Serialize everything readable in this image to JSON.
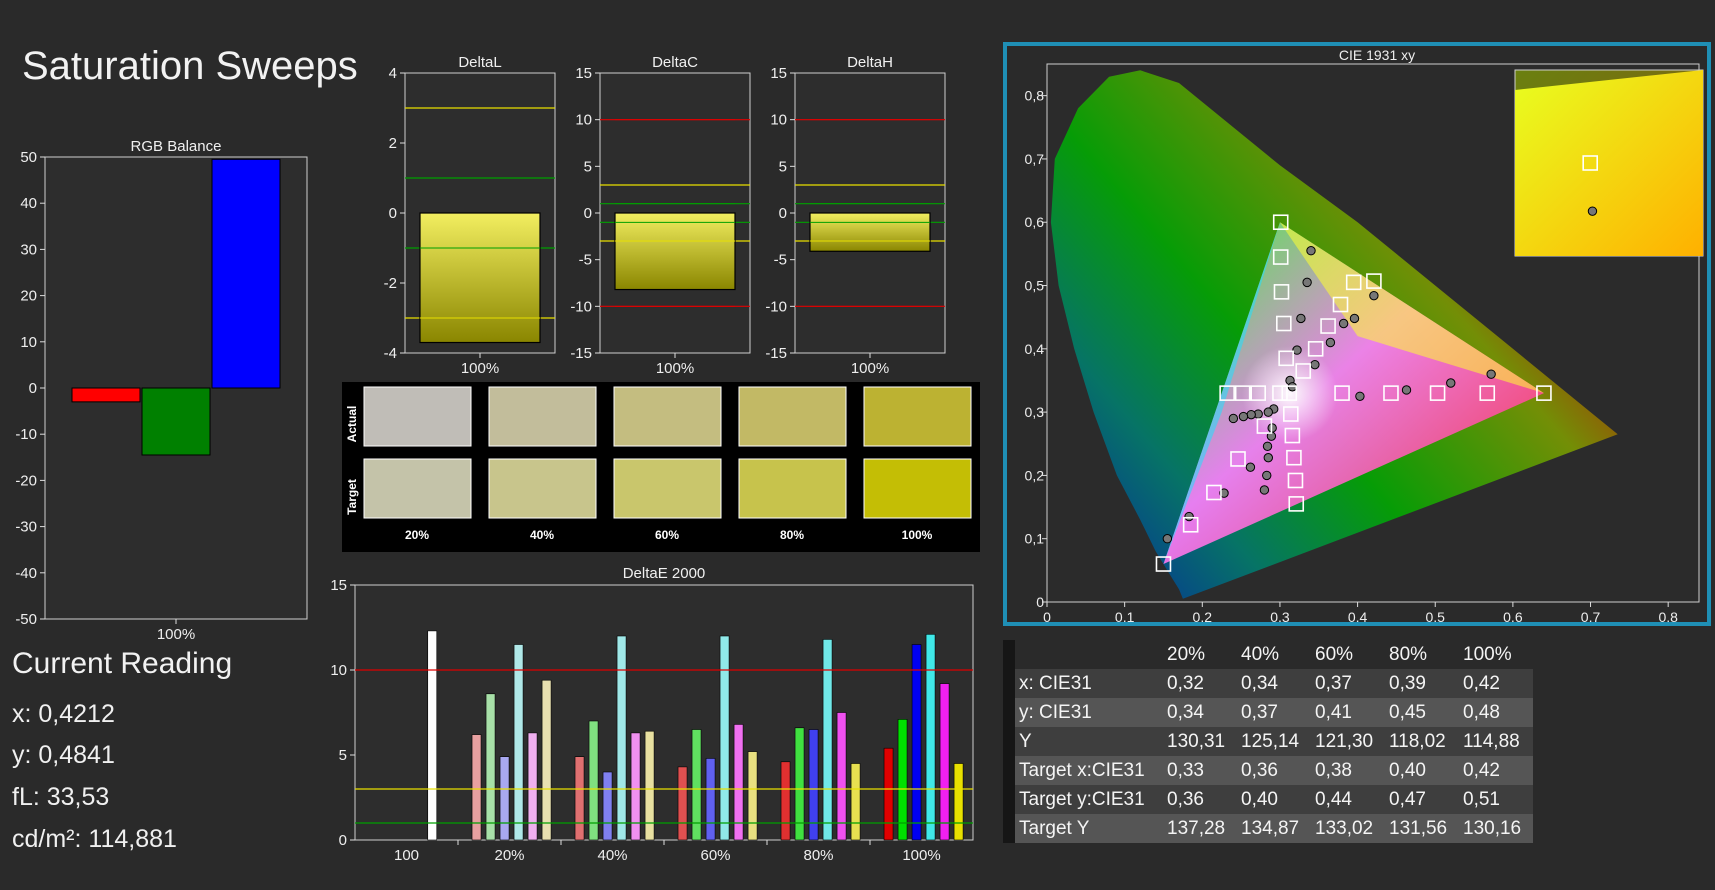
{
  "page": {
    "title": "Saturation Sweeps"
  },
  "reading": {
    "title": "Current Reading",
    "x": "x: 0,4212",
    "y": "y: 0,4841",
    "fl": "fL: 33,53",
    "cd": "cd/m²: 114,881"
  },
  "swatches": {
    "actual_label": "Actual",
    "target_label": "Target",
    "columns": [
      "20%",
      "40%",
      "60%",
      "80%",
      "100%"
    ],
    "actual_colors": [
      "#c0bdb7",
      "#c2bd9b",
      "#c4bd80",
      "#c2b965",
      "#bcb232"
    ],
    "target_colors": [
      "#c4c3a9",
      "#c8c58c",
      "#c9c66c",
      "#c7c34c",
      "#c4be05"
    ]
  },
  "table": {
    "headers": [
      "20%",
      "40%",
      "60%",
      "80%",
      "100%"
    ],
    "rows": [
      {
        "label": "x: CIE31",
        "values": [
          "0,32",
          "0,34",
          "0,37",
          "0,39",
          "0,42"
        ]
      },
      {
        "label": "y: CIE31",
        "values": [
          "0,34",
          "0,37",
          "0,41",
          "0,45",
          "0,48"
        ]
      },
      {
        "label": "Y",
        "values": [
          "130,31",
          "125,14",
          "121,30",
          "118,02",
          "114,88"
        ]
      },
      {
        "label": "Target x:CIE31",
        "values": [
          "0,33",
          "0,36",
          "0,38",
          "0,40",
          "0,42"
        ]
      },
      {
        "label": "Target y:CIE31",
        "values": [
          "0,36",
          "0,40",
          "0,44",
          "0,47",
          "0,51"
        ]
      },
      {
        "label": "Target Y",
        "values": [
          "137,28",
          "134,87",
          "133,02",
          "131,56",
          "130,16"
        ]
      }
    ]
  },
  "chart_data": [
    {
      "id": "rgb-balance",
      "type": "bar",
      "title": "RGB Balance",
      "categories": [
        "100%"
      ],
      "series": [
        {
          "values": [
            -3
          ],
          "color": "#ff0000"
        },
        {
          "values": [
            -14.5
          ],
          "color": "#008000"
        },
        {
          "values": [
            49.5
          ],
          "color": "#0000ff"
        }
      ],
      "ylim": [
        -50,
        50
      ],
      "yticks": [
        "50",
        "40",
        "30",
        "20",
        "10",
        "0",
        "-10",
        "-20",
        "-30",
        "-40",
        "-50"
      ],
      "yticks_values": [
        50,
        40,
        30,
        20,
        10,
        0,
        -10,
        -20,
        -30,
        -40,
        -50
      ],
      "xlabel": "100%"
    },
    {
      "id": "delta-l",
      "type": "bar",
      "title": "DeltaL",
      "categories": [
        "100%"
      ],
      "values": [
        -3.7
      ],
      "ylim": [
        -4,
        4
      ],
      "yticks": [
        "4",
        "2",
        "0",
        "-2",
        "-4"
      ],
      "yticks_values": [
        4,
        2,
        0,
        -2,
        -4
      ],
      "ref_lines": [
        {
          "y": 3,
          "color": "#e8e000"
        },
        {
          "y": 1,
          "color": "#00a000"
        },
        {
          "y": -1,
          "color": "#00a000"
        },
        {
          "y": -3,
          "color": "#e8e000"
        }
      ],
      "xlabel": "100%"
    },
    {
      "id": "delta-c",
      "type": "bar",
      "title": "DeltaC",
      "categories": [
        "100%"
      ],
      "values": [
        -8.2
      ],
      "ylim": [
        -15,
        15
      ],
      "yticks": [
        "15",
        "10",
        "5",
        "0",
        "-5",
        "-10",
        "-15"
      ],
      "yticks_values": [
        15,
        10,
        5,
        0,
        -5,
        -10,
        -15
      ],
      "ref_lines": [
        {
          "y": 10,
          "color": "#e00000"
        },
        {
          "y": 3,
          "color": "#e8e000"
        },
        {
          "y": 1,
          "color": "#00a000"
        },
        {
          "y": -1,
          "color": "#00a000"
        },
        {
          "y": -3,
          "color": "#e8e000"
        },
        {
          "y": -10,
          "color": "#e00000"
        }
      ],
      "xlabel": "100%"
    },
    {
      "id": "delta-h",
      "type": "bar",
      "title": "DeltaH",
      "categories": [
        "100%"
      ],
      "values": [
        -4.1
      ],
      "ylim": [
        -15,
        15
      ],
      "yticks": [
        "15",
        "10",
        "5",
        "0",
        "-5",
        "-10",
        "-15"
      ],
      "yticks_values": [
        15,
        10,
        5,
        0,
        -5,
        -10,
        -15
      ],
      "ref_lines": [
        {
          "y": 10,
          "color": "#e00000"
        },
        {
          "y": 3,
          "color": "#e8e000"
        },
        {
          "y": 1,
          "color": "#00a000"
        },
        {
          "y": -1,
          "color": "#00a000"
        },
        {
          "y": -3,
          "color": "#e8e000"
        },
        {
          "y": -10,
          "color": "#e00000"
        }
      ],
      "xlabel": "100%"
    },
    {
      "id": "delta-e",
      "type": "bar",
      "title": "DeltaE 2000",
      "categories": [
        "100",
        "20%",
        "40%",
        "60%",
        "80%",
        "100%"
      ],
      "groups": [
        {
          "label": "100",
          "bars": [
            {
              "v": 12.3,
              "c": "#ffffff"
            }
          ]
        },
        {
          "label": "20%",
          "bars": [
            {
              "v": 6.2,
              "c": "#e8a0a0"
            },
            {
              "v": 8.6,
              "c": "#a8e0a8"
            },
            {
              "v": 4.9,
              "c": "#a8a8f0"
            },
            {
              "v": 11.5,
              "c": "#b0e8e8"
            },
            {
              "v": 6.3,
              "c": "#f0b0f0"
            },
            {
              "v": 9.4,
              "c": "#e8e0b0"
            }
          ]
        },
        {
          "label": "40%",
          "bars": [
            {
              "v": 4.9,
              "c": "#e07070"
            },
            {
              "v": 7.0,
              "c": "#80e080"
            },
            {
              "v": 4.0,
              "c": "#8080f0"
            },
            {
              "v": 12.0,
              "c": "#a0e8e8"
            },
            {
              "v": 6.3,
              "c": "#f090f0"
            },
            {
              "v": 6.4,
              "c": "#e8e0a0"
            }
          ]
        },
        {
          "label": "60%",
          "bars": [
            {
              "v": 4.3,
              "c": "#e05050"
            },
            {
              "v": 6.5,
              "c": "#60e060"
            },
            {
              "v": 4.8,
              "c": "#6060f0"
            },
            {
              "v": 12.0,
              "c": "#90e8e8"
            },
            {
              "v": 6.8,
              "c": "#f070f0"
            },
            {
              "v": 5.2,
              "c": "#e8e080"
            }
          ]
        },
        {
          "label": "80%",
          "bars": [
            {
              "v": 4.6,
              "c": "#e03030"
            },
            {
              "v": 6.6,
              "c": "#40e040"
            },
            {
              "v": 6.5,
              "c": "#4040f0"
            },
            {
              "v": 11.8,
              "c": "#70e8e8"
            },
            {
              "v": 7.5,
              "c": "#f050f0"
            },
            {
              "v": 4.5,
              "c": "#e8e050"
            }
          ]
        },
        {
          "label": "100%",
          "bars": [
            {
              "v": 5.4,
              "c": "#e00000"
            },
            {
              "v": 7.1,
              "c": "#00e000"
            },
            {
              "v": 11.5,
              "c": "#0000f0"
            },
            {
              "v": 12.1,
              "c": "#40e8e8"
            },
            {
              "v": 9.2,
              "c": "#f020f0"
            },
            {
              "v": 4.5,
              "c": "#e8e000"
            }
          ]
        }
      ],
      "ylim": [
        0,
        15
      ],
      "yticks": [
        "15",
        "10",
        "5",
        "0"
      ],
      "yticks_values": [
        15,
        10,
        5,
        0
      ],
      "ref_lines": [
        {
          "y": 10,
          "color": "#e00000"
        },
        {
          "y": 3,
          "color": "#e8e000"
        },
        {
          "y": 1,
          "color": "#00a000"
        }
      ]
    },
    {
      "id": "cie-1931",
      "type": "scatter",
      "title": "CIE 1931 xy",
      "xlim": [
        0,
        0.85
      ],
      "ylim": [
        0,
        0.85
      ],
      "xticks": [
        "0",
        "0,1",
        "0,2",
        "0,3",
        "0,4",
        "0,5",
        "0,6",
        "0,7",
        "0,8"
      ],
      "xticks_values": [
        0,
        0.1,
        0.2,
        0.3,
        0.4,
        0.5,
        0.6,
        0.7,
        0.8
      ],
      "yticks": [
        "0,8",
        "0,7",
        "0,6",
        "0,5",
        "0,4",
        "0,3",
        "0,2",
        "0,1",
        "0"
      ],
      "yticks_values": [
        0.8,
        0.7,
        0.6,
        0.5,
        0.4,
        0.3,
        0.2,
        0.1,
        0
      ],
      "gamut": [
        [
          0.64,
          0.33
        ],
        [
          0.3,
          0.6
        ],
        [
          0.15,
          0.06
        ]
      ],
      "white": [
        0.3127,
        0.329
      ],
      "targets": [
        [
          0.301,
          0.6
        ],
        [
          0.301,
          0.545
        ],
        [
          0.302,
          0.49
        ],
        [
          0.305,
          0.44
        ],
        [
          0.308,
          0.385
        ],
        [
          0.3,
          0.33
        ],
        [
          0.312,
          0.33
        ],
        [
          0.272,
          0.33
        ],
        [
          0.252,
          0.33
        ],
        [
          0.232,
          0.33
        ],
        [
          0.38,
          0.33
        ],
        [
          0.443,
          0.33
        ],
        [
          0.503,
          0.33
        ],
        [
          0.567,
          0.33
        ],
        [
          0.64,
          0.33
        ],
        [
          0.28,
          0.278
        ],
        [
          0.246,
          0.226
        ],
        [
          0.215,
          0.173
        ],
        [
          0.185,
          0.122
        ],
        [
          0.15,
          0.06
        ],
        [
          0.314,
          0.297
        ],
        [
          0.316,
          0.263
        ],
        [
          0.318,
          0.228
        ],
        [
          0.32,
          0.192
        ],
        [
          0.321,
          0.155
        ],
        [
          0.33,
          0.365
        ],
        [
          0.346,
          0.4
        ],
        [
          0.362,
          0.436
        ],
        [
          0.378,
          0.47
        ],
        [
          0.395,
          0.505
        ],
        [
          0.421,
          0.507
        ]
      ],
      "measured": [
        [
          0.34,
          0.555
        ],
        [
          0.335,
          0.505
        ],
        [
          0.327,
          0.448
        ],
        [
          0.322,
          0.398
        ],
        [
          0.313,
          0.35
        ],
        [
          0.316,
          0.34
        ],
        [
          0.292,
          0.305
        ],
        [
          0.285,
          0.3
        ],
        [
          0.272,
          0.297
        ],
        [
          0.263,
          0.296
        ],
        [
          0.253,
          0.293
        ],
        [
          0.24,
          0.29
        ],
        [
          0.403,
          0.325
        ],
        [
          0.463,
          0.335
        ],
        [
          0.52,
          0.346
        ],
        [
          0.572,
          0.36
        ],
        [
          0.29,
          0.275
        ],
        [
          0.284,
          0.246
        ],
        [
          0.262,
          0.213
        ],
        [
          0.228,
          0.172
        ],
        [
          0.183,
          0.135
        ],
        [
          0.155,
          0.1
        ],
        [
          0.289,
          0.262
        ],
        [
          0.285,
          0.228
        ],
        [
          0.283,
          0.2
        ],
        [
          0.28,
          0.177
        ],
        [
          0.345,
          0.375
        ],
        [
          0.365,
          0.41
        ],
        [
          0.382,
          0.44
        ],
        [
          0.396,
          0.448
        ],
        [
          0.421,
          0.484
        ]
      ],
      "inset": {
        "target": [
          0.42,
          0.51
        ],
        "measured": [
          0.4212,
          0.4841
        ]
      }
    }
  ]
}
